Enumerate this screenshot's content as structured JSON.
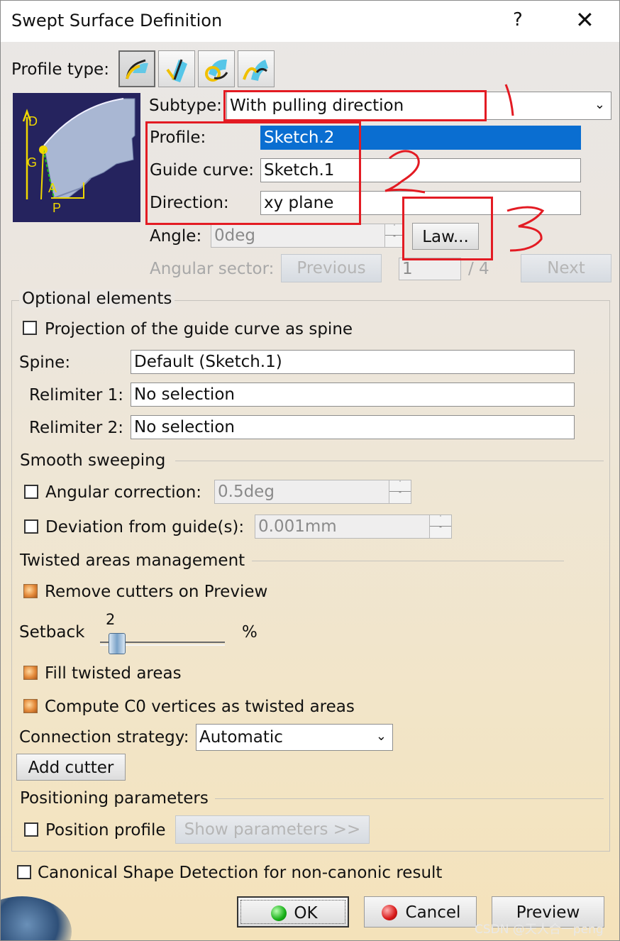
{
  "window": {
    "title": "Swept Surface Definition",
    "help": "?",
    "close": "✕"
  },
  "profile_type": {
    "label": "Profile type:",
    "buttons": [
      "profile-explicit",
      "profile-line",
      "profile-circle",
      "profile-conic"
    ]
  },
  "subtype": {
    "label": "Subtype:",
    "value": "With pulling direction"
  },
  "profile": {
    "label": "Profile:",
    "value": "Sketch.2"
  },
  "guide_curve": {
    "label": "Guide curve:",
    "value": "Sketch.1"
  },
  "direction": {
    "label": "Direction:",
    "value": "xy plane"
  },
  "angle": {
    "label": "Angle:",
    "value": "0deg",
    "law_button": "Law..."
  },
  "angular_sector": {
    "label": "Angular sector:",
    "previous": "Previous",
    "value": "1",
    "total": "/ 4",
    "next": "Next"
  },
  "preview_labels": {
    "d": "D",
    "g": "G",
    "a": "A",
    "p": "P"
  },
  "optional": {
    "title": "Optional elements",
    "projection_label": "Projection of the guide curve as spine",
    "spine_label": "Spine:",
    "spine_value": "Default (Sketch.1)",
    "relimiter1_label": "Relimiter 1:",
    "relimiter1_value": "No selection",
    "relimiter2_label": "Relimiter 2:",
    "relimiter2_value": "No selection"
  },
  "smooth": {
    "title": "Smooth sweeping",
    "angular_label": "Angular correction:",
    "angular_value": "0.5deg",
    "deviation_label": "Deviation from guide(s):",
    "deviation_value": "0.001mm"
  },
  "twisted": {
    "title": "Twisted areas management",
    "remove_cutters": "Remove cutters on Preview",
    "setback_label": "Setback",
    "setback_value": "2",
    "setback_unit": "%",
    "setback_fraction": 0.08,
    "fill_twisted": "Fill twisted areas",
    "compute_c0": "Compute C0 vertices as twisted areas",
    "connection_label": "Connection strategy:",
    "connection_value": "Automatic",
    "add_cutter": "Add cutter"
  },
  "positioning": {
    "title": "Positioning parameters",
    "position_profile": "Position profile",
    "show_parameters": "Show parameters >>"
  },
  "canonical_label": "Canonical Shape Detection for non-canonic result",
  "buttons": {
    "ok": "OK",
    "cancel": "Cancel",
    "preview": "Preview"
  },
  "annotations": {
    "mark1": "1",
    "mark2": "2",
    "mark3": "3",
    "color": "#e31b23"
  },
  "watermark": "CSDN @天人合一peng"
}
